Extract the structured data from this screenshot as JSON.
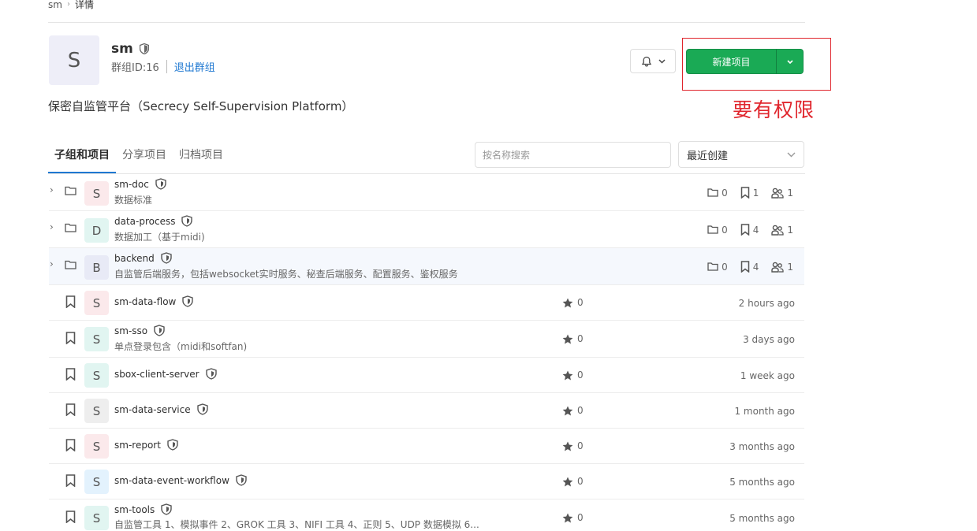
{
  "breadcrumb": {
    "root": "sm",
    "current": "详情"
  },
  "group": {
    "avatar_letter": "S",
    "name": "sm",
    "id_text": "群组ID:16",
    "leave_link": "退出群组",
    "description": "保密自监管平台（Secrecy Self-Supervision Platform）"
  },
  "header_actions": {
    "new_project_label": "新建项目",
    "annotation": "要有权限"
  },
  "tabs": [
    {
      "label": "子组和项目",
      "active": true
    },
    {
      "label": "分享项目",
      "active": false
    },
    {
      "label": "归档项目",
      "active": false
    }
  ],
  "search": {
    "placeholder": "按名称搜索",
    "value": ""
  },
  "sort": {
    "selected": "最近创建"
  },
  "subgroups": [
    {
      "letter": "S",
      "color": "#fbe9eb",
      "name": "sm-doc",
      "desc": "数据标准",
      "subgroups": "0",
      "projects": "1",
      "members": "1",
      "highlighted": false
    },
    {
      "letter": "D",
      "color": "#e1f5f1",
      "name": "data-process",
      "desc": "数据加工（基于midi)",
      "subgroups": "0",
      "projects": "4",
      "members": "1",
      "highlighted": false
    },
    {
      "letter": "B",
      "color": "#e8eaf6",
      "name": "backend",
      "desc": "自监管后端服务，包括websocket实时服务、秘查后端服务、配置服务、鉴权服务",
      "subgroups": "0",
      "projects": "4",
      "members": "1",
      "highlighted": true
    }
  ],
  "projects": [
    {
      "letter": "S",
      "color": "#fbe9eb",
      "name": "sm-data-flow",
      "desc": "",
      "stars": "0",
      "time": "2 hours ago"
    },
    {
      "letter": "S",
      "color": "#e1f5f1",
      "name": "sm-sso",
      "desc": "单点登录包含（midi和softfan)",
      "stars": "0",
      "time": "3 days ago"
    },
    {
      "letter": "S",
      "color": "#e1f5f1",
      "name": "sbox-client-server",
      "desc": "",
      "stars": "0",
      "time": "1 week ago"
    },
    {
      "letter": "S",
      "color": "#eeeeee",
      "name": "sm-data-service",
      "desc": "",
      "stars": "0",
      "time": "1 month ago"
    },
    {
      "letter": "S",
      "color": "#fbe9eb",
      "name": "sm-report",
      "desc": "",
      "stars": "0",
      "time": "3 months ago"
    },
    {
      "letter": "S",
      "color": "#e3f2fd",
      "name": "sm-data-event-workflow",
      "desc": "",
      "stars": "0",
      "time": "5 months ago"
    },
    {
      "letter": "S",
      "color": "#e1f5f1",
      "name": "sm-tools",
      "desc": "自监管工具 1、模拟事件 2、GROK 工具 3、NIFI 工具 4、正则 5、UDP 数据模拟 6...",
      "stars": "0",
      "time": "5 months ago"
    }
  ],
  "icons": {
    "shield": "shield-icon",
    "bell": "bell-icon",
    "caret": "chevron-down-icon",
    "folder": "folder-icon",
    "bookmark": "bookmark-icon",
    "users": "users-icon",
    "star": "star-icon",
    "chevron_right": "chevron-right-icon"
  },
  "colors": {
    "primary_green": "#1aaa55",
    "link_blue": "#1f78d1",
    "annotation_red": "#e0262d"
  }
}
